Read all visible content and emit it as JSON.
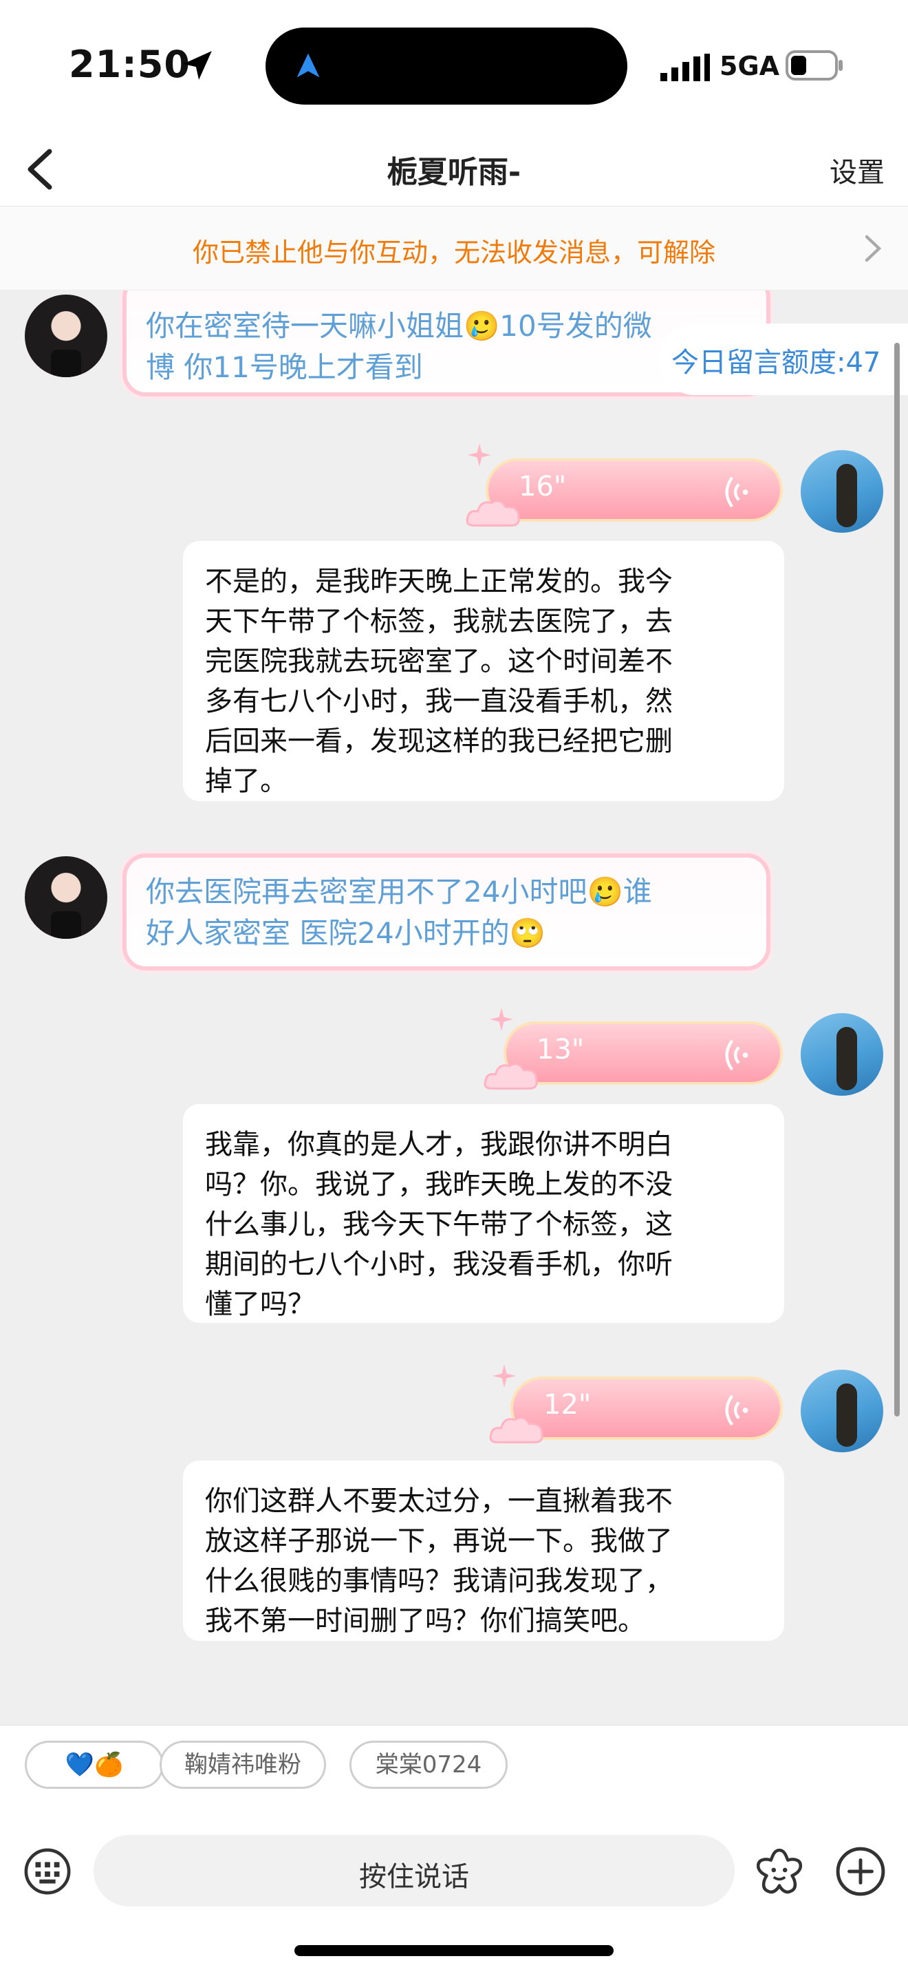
{
  "status_bar": {
    "time": "21:50",
    "network": "5GA"
  },
  "nav": {
    "title": "栀夏听雨-",
    "settings_label": "设置"
  },
  "banner": {
    "text": "你已禁止他与你互动，无法收发消息，可解除"
  },
  "quota": {
    "label": "今日留言额度:47"
  },
  "messages": [
    {
      "side": "left",
      "type": "text",
      "text_line1": "你在密室待一天嘛小姐姐🥲10号发的微",
      "text_line2": "博 你11号晚上才看到"
    },
    {
      "side": "right",
      "type": "voice",
      "duration": "16\""
    },
    {
      "side": "right",
      "type": "text",
      "lines": [
        "不是的，是我昨天晚上正常发的。我今",
        "天下午带了个标签，我就去医院了，去",
        "完医院我就去玩密室了。这个时间差不",
        "多有七八个小时，我一直没看手机，然",
        "后回来一看，发现这样的我已经把它删",
        "掉了。"
      ]
    },
    {
      "side": "left",
      "type": "text",
      "text_line1": "你去医院再去密室用不了24小时吧🥲谁",
      "text_line2": "好人家密室 医院24小时开的🙄"
    },
    {
      "side": "right",
      "type": "voice",
      "duration": "13\""
    },
    {
      "side": "right",
      "type": "text",
      "lines": [
        "我靠，你真的是人才，我跟你讲不明白",
        "吗？你。我说了，我昨天晚上发的不没",
        "什么事儿，我今天下午带了个标签，这",
        "期间的七八个小时，我没看手机，你听",
        "懂了吗？"
      ]
    },
    {
      "side": "right",
      "type": "voice",
      "duration": "12\""
    },
    {
      "side": "right",
      "type": "text",
      "lines": [
        "你们这群人不要太过分，一直揪着我不",
        "放这样子那说一下，再说一下。我做了",
        "什么很贱的事情吗？我请问我发现了，",
        "我不第一时间删了吗？你们搞笑吧。"
      ]
    }
  ],
  "chips": [
    {
      "label": "💙🍊"
    },
    {
      "label": "鞠婧祎唯粉"
    },
    {
      "label": "棠棠0724"
    }
  ],
  "input": {
    "hold_to_talk": "按住说话"
  },
  "icons": {
    "location": "location-arrow-icon",
    "back": "chevron-left-icon",
    "banner": "chevron-right-icon",
    "voice": "sound-wave-icon",
    "keyboard": "keyboard-icon",
    "emoji": "flower-emoji-icon",
    "plus": "plus-circle-icon"
  },
  "colors": {
    "banner_text": "#f07a0a",
    "quota_text": "#3a8ad8",
    "pink_bubble_text": "#5e9fd6",
    "voice_bubble": "#ff9fae"
  }
}
